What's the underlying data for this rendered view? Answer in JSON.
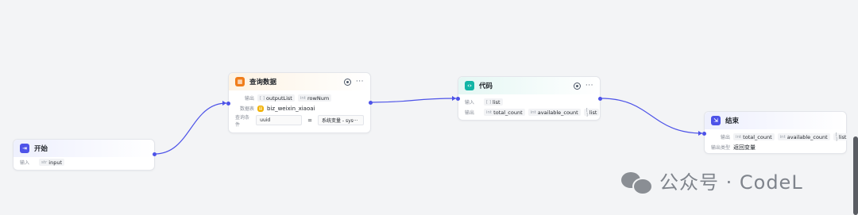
{
  "nodes": {
    "start": {
      "title": "开始",
      "inputs_label": "输入",
      "inputs": [
        {
          "type": "str",
          "name": "input"
        }
      ]
    },
    "query": {
      "title": "查询数据",
      "output_label": "输出",
      "outputs": [
        {
          "type": "[ ]",
          "name": "outputList"
        },
        {
          "type": "int",
          "name": "rowNum"
        }
      ],
      "db_label": "数据表",
      "db_name": "biz_weixin_xiaoai",
      "cond_label": "查询条件",
      "cond_field": "uuid",
      "cond_op": "=",
      "cond_value": "系统变量 - sys···"
    },
    "code": {
      "title": "代码",
      "input_label": "输入",
      "inputs": [
        {
          "type": "[ ]",
          "name": "list"
        }
      ],
      "output_label": "输出",
      "outputs": [
        {
          "type": "int",
          "name": "total_count"
        },
        {
          "type": "int",
          "name": "available_count"
        },
        {
          "type": "[ ]",
          "name": "list"
        }
      ]
    },
    "end": {
      "title": "结束",
      "output_label": "输出",
      "outputs": [
        {
          "type": "int",
          "name": "total_count"
        },
        {
          "type": "int",
          "name": "available_count"
        },
        {
          "type": "[ ]",
          "name": "list"
        }
      ],
      "type_label": "输出类型",
      "type_value": "返回变量"
    }
  },
  "watermark": {
    "text": "公众号 · CodeL"
  },
  "colors": {
    "accent": "#4d53e8",
    "query": "#f07d1a",
    "code": "#12b5a6",
    "start": "#4d53e8",
    "end": "#4d53e8"
  }
}
